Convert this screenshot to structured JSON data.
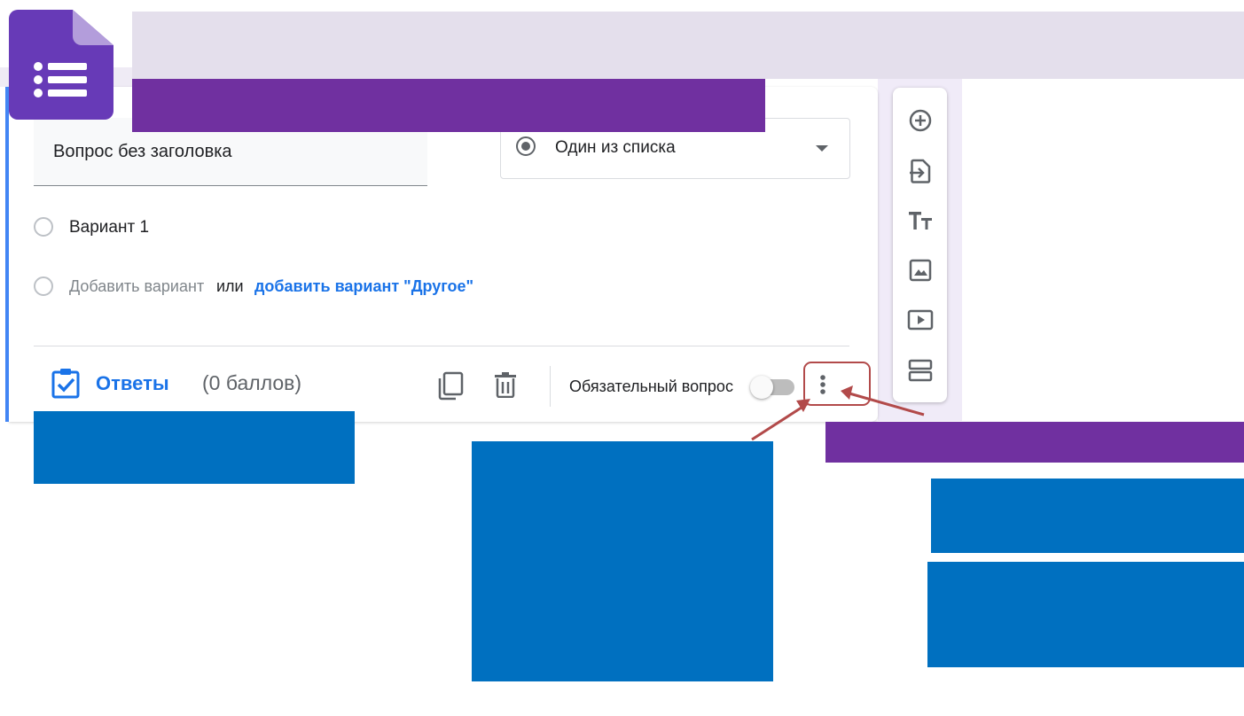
{
  "question": {
    "title": "Вопрос без заголовка",
    "type_label": "Один из списка",
    "option1": "Вариант 1",
    "add_option": "Добавить вариант",
    "or": "или",
    "add_other": "добавить вариант \"Другое\""
  },
  "footer": {
    "answers_label": "Ответы",
    "points": "(0 баллов)",
    "required_label": "Обязательный вопрос",
    "required_on": false
  },
  "toolbar": {
    "icons": [
      "add-question-icon",
      "import-questions-icon",
      "add-title-icon",
      "add-image-icon",
      "add-video-icon",
      "add-section-icon"
    ]
  },
  "colors": {
    "accent_blue": "#1a73e8",
    "annotation_red": "#b24a4a",
    "overlay_purple": "#7030a0",
    "overlay_blue": "#0070c0",
    "forms_purple": "#673ab7"
  }
}
